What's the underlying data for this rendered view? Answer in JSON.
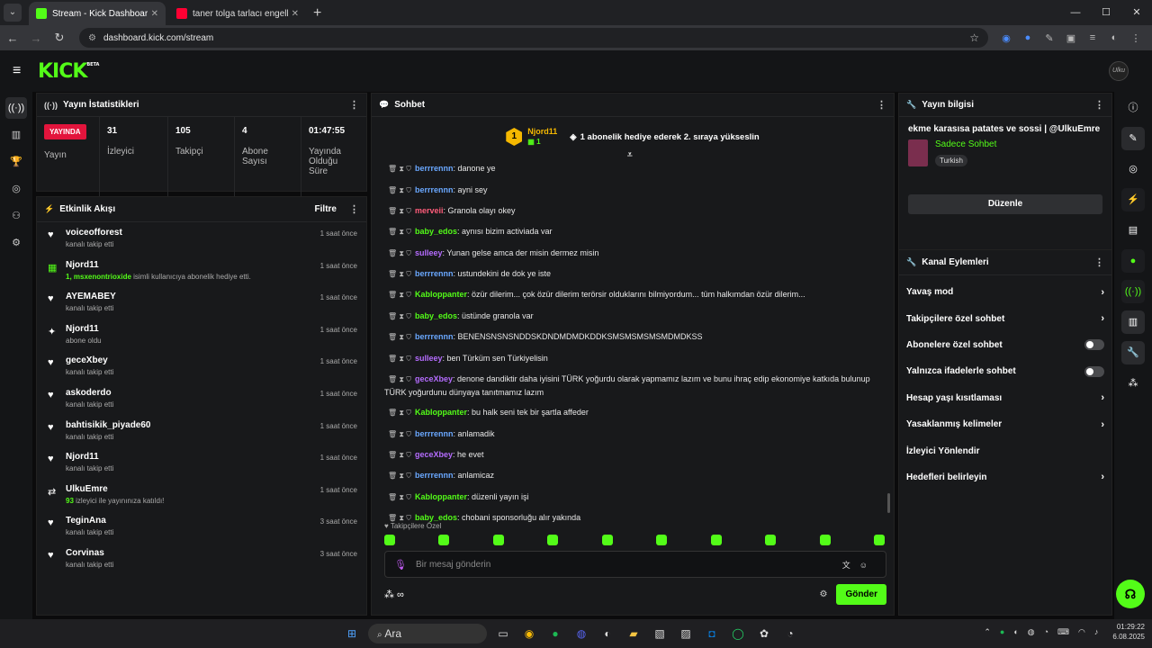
{
  "browser": {
    "tabs": [
      {
        "title": "Stream - Kick Dashboard",
        "active": true,
        "favcolor": "#53fc18"
      },
      {
        "title": "taner tolga tarlacı engelli hayrana...",
        "active": false,
        "favcolor": "#ff0033"
      }
    ],
    "new_tab": "+",
    "url": "dashboard.kick.com/stream",
    "win_controls": [
      "—",
      "☐",
      "✕"
    ]
  },
  "kick": {
    "logo": "KICK",
    "beta": "BETA",
    "avatar": "Ulku"
  },
  "stats": {
    "title": "Yayın İstatistikleri",
    "live_badge": "YAYINDA",
    "live_label": "Yayın",
    "items": [
      {
        "value": "31",
        "label": "İzleyici"
      },
      {
        "value": "105",
        "label": "Takipçi"
      },
      {
        "value": "4",
        "label": "Abone Sayısı"
      },
      {
        "value": "01:47:55",
        "label": "Yayında Olduğu Süre"
      }
    ]
  },
  "activity": {
    "title": "Etkinlik Akışı",
    "filter": "Filtre",
    "rows": [
      {
        "icon": "♥",
        "name": "voiceofforest",
        "sub": "kanalı takip etti",
        "time": "1 saat önce"
      },
      {
        "icon": "▦",
        "name": "Njord11",
        "sub_hl": "1, msxenontrioxide",
        "sub": " isimli kullanıcıya abonelik hediye etti.",
        "time": "1 saat önce",
        "green": true
      },
      {
        "icon": "♥",
        "name": "AYEMABEY",
        "sub": "kanalı takip etti",
        "time": "1 saat önce"
      },
      {
        "icon": "✦",
        "name": "Njord11",
        "sub": "abone oldu",
        "time": "1 saat önce"
      },
      {
        "icon": "♥",
        "name": "geceXbey",
        "sub": "kanalı takip etti",
        "time": "1 saat önce"
      },
      {
        "icon": "♥",
        "name": "askoderdo",
        "sub": "kanalı takip etti",
        "time": "1 saat önce"
      },
      {
        "icon": "♥",
        "name": "bahtisikik_piyade60",
        "sub": "kanalı takip etti",
        "time": "1 saat önce"
      },
      {
        "icon": "♥",
        "name": "Njord11",
        "sub": "kanalı takip etti",
        "time": "1 saat önce"
      },
      {
        "icon": "⇄",
        "name": "UlkuEmre",
        "sub_hl": "93",
        "sub": " izleyici ile yayınınıza katıldı!",
        "time": "1 saat önce"
      },
      {
        "icon": "♥",
        "name": "TeginAna",
        "sub": "kanalı takip etti",
        "time": "3 saat önce"
      },
      {
        "icon": "♥",
        "name": "Corvinas",
        "sub": "kanalı takip etti",
        "time": "3 saat önce"
      }
    ]
  },
  "chat": {
    "title": "Sohbet",
    "pinned_user": "Njord11",
    "pinned_badge": "1",
    "pinned_count": "1",
    "pinned_msg": "1 abonelik hediye ederek 2. sıraya yükseslin",
    "messages": [
      {
        "user": "berrrennn",
        "color": "#6aa8ff",
        "text": ": danone ye"
      },
      {
        "user": "berrrennn",
        "color": "#6aa8ff",
        "text": ": ayni sey"
      },
      {
        "user": "merveii",
        "color": "#ff5c7a",
        "text": ": Granola olayı okey"
      },
      {
        "user": "baby_edos",
        "color": "#53fc18",
        "text": ": aynısı bizim activiada var"
      },
      {
        "user": "sulleey",
        "color": "#b56cff",
        "text": ": Yunan gelse amca der misin dermez misin"
      },
      {
        "user": "berrrennn",
        "color": "#6aa8ff",
        "text": ": ustundekini de dok ye iste"
      },
      {
        "user": "Kabloppanter",
        "color": "#53fc18",
        "text": ": özür dilerim... çok özür dilerim terörsir olduklarını bilmiyordum... tüm halkımdan özür dilerim..."
      },
      {
        "user": "baby_edos",
        "color": "#53fc18",
        "text": ": üstünde granola var"
      },
      {
        "user": "berrrennn",
        "color": "#6aa8ff",
        "text": ": BENENSNSNSNDDSKDNDMDMDKDDKSMSMSMSMSMDMDKSS"
      },
      {
        "user": "sulleey",
        "color": "#b56cff",
        "text": ": ben Türküm sen Türkiyelisin"
      },
      {
        "user": "geceXbey",
        "color": "#b56cff",
        "text": ": denone dandiktir daha iyisini TÜRK yoğurdu olarak yapmamız lazım ve bunu ihraç edip ekonomiye katkıda bulunup TÜRK yoğurdunu dünyaya tanıtmamız lazım"
      },
      {
        "user": "Kabloppanter",
        "color": "#53fc18",
        "text": ": bu halk seni tek bir şartla affeder"
      },
      {
        "user": "berrrennn",
        "color": "#6aa8ff",
        "text": ": anlamadik"
      },
      {
        "user": "geceXbey",
        "color": "#b56cff",
        "text": ": he evet"
      },
      {
        "user": "berrrennn",
        "color": "#6aa8ff",
        "text": ": anlamicaz"
      },
      {
        "user": "Kabloppanter",
        "color": "#53fc18",
        "text": ": düzenli yayın işi"
      },
      {
        "user": "baby_edos",
        "color": "#53fc18",
        "text": ": chobani sponsorluğu alır yakında"
      }
    ],
    "followers_only": "♥ Takipçilere Özel",
    "placeholder": "Bir mesaj gönderin",
    "send": "Gönder"
  },
  "stream_info": {
    "title": "Yayın bilgisi",
    "stream_title": "ekme karasısa patates ve sossi | @UlkuEmre",
    "category": "Sadece Sohbet",
    "tag": "Turkish",
    "edit": "Düzenle"
  },
  "channel_actions": {
    "title": "Kanal Eylemleri",
    "rows": [
      {
        "label": "Yavaş mod",
        "ctl": "chevron"
      },
      {
        "label": "Takipçilere özel sohbet",
        "ctl": "chevron"
      },
      {
        "label": "Abonelere özel sohbet",
        "ctl": "toggle"
      },
      {
        "label": "Yalnızca ifadelerle sohbet",
        "ctl": "toggle"
      },
      {
        "label": "Hesap yaşı kısıtlaması",
        "ctl": "chevron"
      },
      {
        "label": "Yasaklanmış kelimeler",
        "ctl": "chevron"
      },
      {
        "label": "İzleyici Yönlendir",
        "ctl": "none"
      },
      {
        "label": "Hedefleri belirleyin",
        "ctl": "chevron"
      }
    ]
  },
  "taskbar": {
    "search": "Ara",
    "time": "01:29:22",
    "date": "6.08.2025"
  }
}
